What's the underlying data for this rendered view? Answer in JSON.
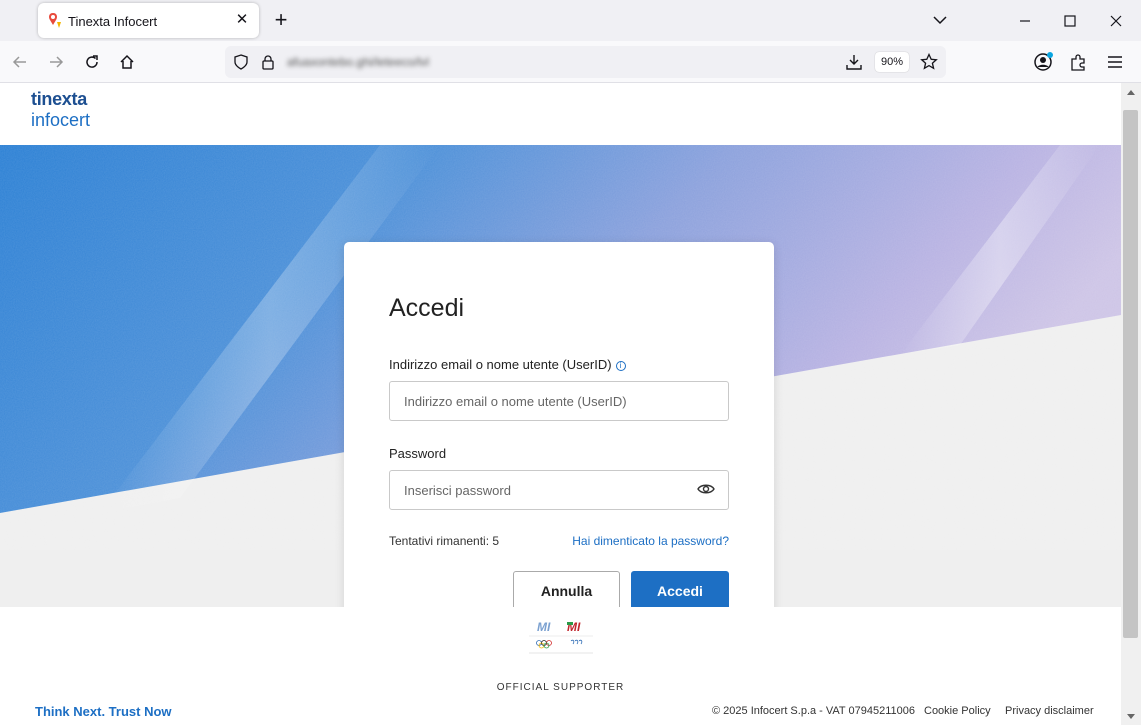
{
  "browser": {
    "tab_title": "Tinexta Infocert",
    "url": "afuaxontebo.ghi/leteeco/lvl",
    "zoom": "90%"
  },
  "header": {
    "logo_line1": "tinexta",
    "logo_line2": "infocert"
  },
  "login": {
    "title": "Accedi",
    "user_label": "Indirizzo email o nome utente (UserID)",
    "user_placeholder": "Indirizzo email o nome utente (UserID)",
    "password_label": "Password",
    "password_placeholder": "Inserisci password",
    "attempts": "Tentativi rimanenti: 5",
    "forgot": "Hai dimenticato la password?",
    "cancel_label": "Annulla",
    "submit_label": "Accedi"
  },
  "footer": {
    "official_supporter": "OFFICIAL SUPPORTER",
    "slogan": "Think Next. Trust Now",
    "copyright": "© 2025 Infocert S.p.a - VAT 07945211006",
    "cookie_policy": "Cookie Policy",
    "privacy": "Privacy disclaimer"
  },
  "colors": {
    "brand_blue": "#1d6fc4",
    "brand_dark": "#1d4f91",
    "hero_blue": "#2a7fd4",
    "hero_lilac": "#c6bfe4"
  }
}
